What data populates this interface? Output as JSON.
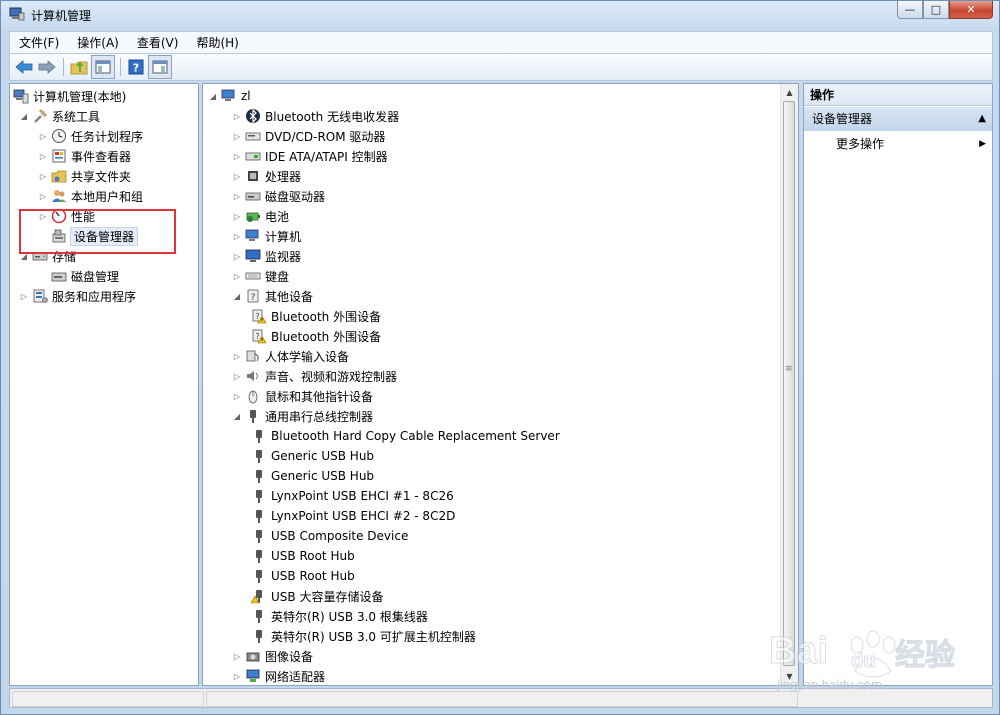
{
  "window": {
    "title": "计算机管理",
    "buttons": {
      "minimize": "—",
      "maximize": "□",
      "close": "✕"
    }
  },
  "menu": [
    "文件(F)",
    "操作(A)",
    "查看(V)",
    "帮助(H)"
  ],
  "left_tree": [
    {
      "label": "计算机管理(本地)",
      "arrow": "",
      "indent": 0,
      "icon": "computer-management-icon"
    },
    {
      "label": "系统工具",
      "arrow": "◢",
      "indent": 1,
      "icon": "tools-icon"
    },
    {
      "label": "任务计划程序",
      "arrow": "▷",
      "indent": 2,
      "icon": "clock-icon"
    },
    {
      "label": "事件查看器",
      "arrow": "▷",
      "indent": 2,
      "icon": "event-viewer-icon"
    },
    {
      "label": "共享文件夹",
      "arrow": "▷",
      "indent": 2,
      "icon": "shared-folder-icon"
    },
    {
      "label": "本地用户和组",
      "arrow": "▷",
      "indent": 2,
      "icon": "users-icon"
    },
    {
      "label": "性能",
      "arrow": "▷",
      "indent": 2,
      "icon": "performance-icon"
    },
    {
      "label": "设备管理器",
      "arrow": "",
      "indent": 2,
      "icon": "device-manager-icon",
      "selected": true
    },
    {
      "label": "存储",
      "arrow": "◢",
      "indent": 1,
      "icon": "storage-icon"
    },
    {
      "label": "磁盘管理",
      "arrow": "",
      "indent": 2,
      "icon": "disk-management-icon"
    },
    {
      "label": "服务和应用程序",
      "arrow": "▷",
      "indent": 1,
      "icon": "services-icon"
    }
  ],
  "device_tree": [
    {
      "label": "zl",
      "arrow": "◢",
      "indent": 0,
      "icon": "computer-icon"
    },
    {
      "label": "Bluetooth 无线电收发器",
      "arrow": "▷",
      "indent": 1,
      "icon": "bluetooth-icon"
    },
    {
      "label": "DVD/CD-ROM 驱动器",
      "arrow": "▷",
      "indent": 1,
      "icon": "dvd-drive-icon"
    },
    {
      "label": "IDE ATA/ATAPI 控制器",
      "arrow": "▷",
      "indent": 1,
      "icon": "ide-controller-icon"
    },
    {
      "label": "处理器",
      "arrow": "▷",
      "indent": 1,
      "icon": "processor-icon"
    },
    {
      "label": "磁盘驱动器",
      "arrow": "▷",
      "indent": 1,
      "icon": "disk-drive-icon"
    },
    {
      "label": "电池",
      "arrow": "▷",
      "indent": 1,
      "icon": "battery-icon"
    },
    {
      "label": "计算机",
      "arrow": "▷",
      "indent": 1,
      "icon": "computer-icon"
    },
    {
      "label": "监视器",
      "arrow": "▷",
      "indent": 1,
      "icon": "monitor-icon"
    },
    {
      "label": "键盘",
      "arrow": "▷",
      "indent": 1,
      "icon": "keyboard-icon"
    },
    {
      "label": "其他设备",
      "arrow": "◢",
      "indent": 1,
      "icon": "unknown-device-icon"
    },
    {
      "label": "Bluetooth 外围设备",
      "arrow": "",
      "indent": 2,
      "icon": "warning-device-icon"
    },
    {
      "label": "Bluetooth 外围设备",
      "arrow": "",
      "indent": 2,
      "icon": "warning-device-icon"
    },
    {
      "label": "人体学输入设备",
      "arrow": "▷",
      "indent": 1,
      "icon": "hid-icon"
    },
    {
      "label": "声音、视频和游戏控制器",
      "arrow": "▷",
      "indent": 1,
      "icon": "speaker-icon"
    },
    {
      "label": "鼠标和其他指针设备",
      "arrow": "▷",
      "indent": 1,
      "icon": "mouse-icon"
    },
    {
      "label": "通用串行总线控制器",
      "arrow": "◢",
      "indent": 1,
      "icon": "usb-icon"
    },
    {
      "label": "Bluetooth Hard Copy Cable Replacement Server",
      "arrow": "",
      "indent": 2,
      "icon": "usb-icon"
    },
    {
      "label": "Generic USB Hub",
      "arrow": "",
      "indent": 2,
      "icon": "usb-icon"
    },
    {
      "label": "Generic USB Hub",
      "arrow": "",
      "indent": 2,
      "icon": "usb-icon"
    },
    {
      "label": "LynxPoint USB EHCI #1 - 8C26",
      "arrow": "",
      "indent": 2,
      "icon": "usb-icon"
    },
    {
      "label": "LynxPoint USB EHCI #2 - 8C2D",
      "arrow": "",
      "indent": 2,
      "icon": "usb-icon"
    },
    {
      "label": "USB Composite Device",
      "arrow": "",
      "indent": 2,
      "icon": "usb-icon"
    },
    {
      "label": "USB Root Hub",
      "arrow": "",
      "indent": 2,
      "icon": "usb-icon"
    },
    {
      "label": "USB Root Hub",
      "arrow": "",
      "indent": 2,
      "icon": "usb-icon"
    },
    {
      "label": "USB 大容量存储设备",
      "arrow": "",
      "indent": 2,
      "icon": "usb-warning-icon"
    },
    {
      "label": "英特尔(R) USB 3.0 根集线器",
      "arrow": "",
      "indent": 2,
      "icon": "usb-icon"
    },
    {
      "label": "英特尔(R) USB 3.0 可扩展主机控制器",
      "arrow": "",
      "indent": 2,
      "icon": "usb-icon"
    },
    {
      "label": "图像设备",
      "arrow": "▷",
      "indent": 1,
      "icon": "camera-icon"
    },
    {
      "label": "网络适配器",
      "arrow": "▷",
      "indent": 1,
      "icon": "network-adapter-icon"
    }
  ],
  "actions": {
    "header": "操作",
    "section": "设备管理器",
    "more": "更多操作"
  },
  "watermark": {
    "logo": "Bai du 经验",
    "url": "jingyan.baidu.com"
  },
  "colors": {
    "highlight_box": "#e0343a",
    "selection": "#e4ecf7",
    "warning": "#f3c417"
  }
}
